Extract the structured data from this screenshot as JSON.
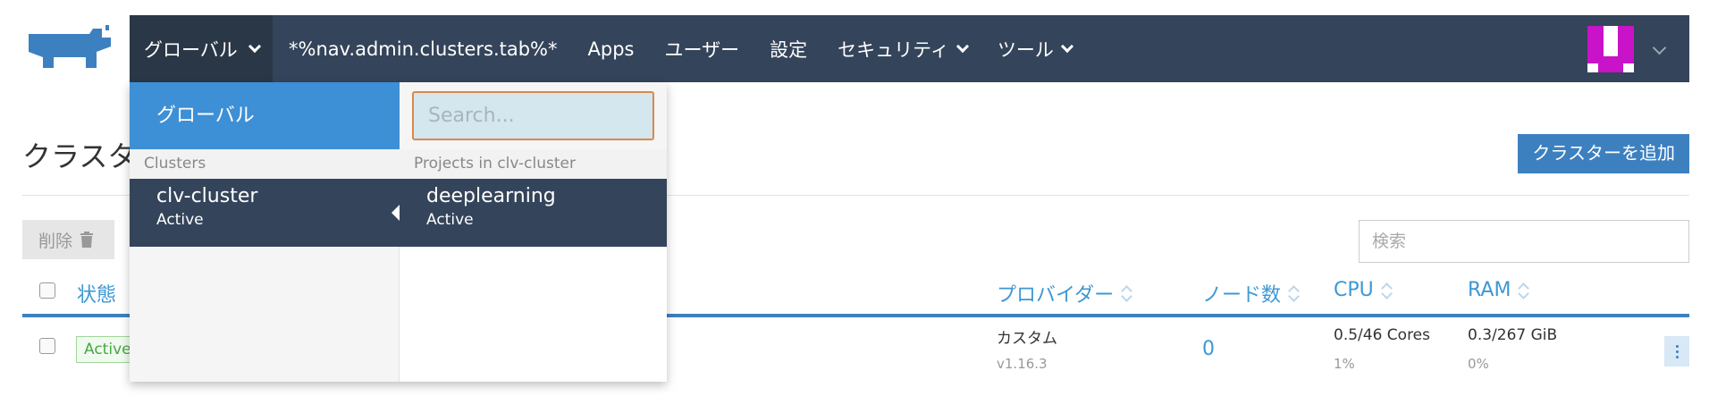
{
  "header": {
    "global_label": "グローバル",
    "nav": [
      {
        "label": "*%nav.admin.clusters.tab%*",
        "has_menu": false
      },
      {
        "label": "Apps",
        "has_menu": false
      },
      {
        "label": "ユーザー",
        "has_menu": false
      },
      {
        "label": "設定",
        "has_menu": false
      },
      {
        "label": "セキュリティ",
        "has_menu": true
      },
      {
        "label": "ツール",
        "has_menu": true
      }
    ]
  },
  "page": {
    "title": "クラスタ",
    "add_button": "クラスターを追加",
    "delete_button": "削除",
    "search_placeholder": "検索"
  },
  "table": {
    "columns": {
      "state": "状態",
      "provider": "プロバイダー",
      "nodes": "ノード数",
      "cpu": "CPU",
      "ram": "RAM"
    },
    "row": {
      "state": "Active",
      "provider": "カスタム",
      "version": "v1.16.3",
      "nodes": "0",
      "cpu": "0.5/46 Cores",
      "cpu_pct": "1%",
      "ram": "0.3/267 GiB",
      "ram_pct": "0%"
    }
  },
  "dropdown": {
    "global_label": "グローバル",
    "search_placeholder": "Search...",
    "clusters_heading": "Clusters",
    "projects_heading": "Projects in clv-cluster",
    "cluster": {
      "name": "clv-cluster",
      "status": "Active"
    },
    "project": {
      "name": "deeplearning",
      "status": "Active"
    }
  },
  "colors": {
    "navbar": "#34445a",
    "accent": "#3d80c0",
    "dropdown_highlight": "#3d8fd6",
    "avatar": "#c813c8"
  }
}
